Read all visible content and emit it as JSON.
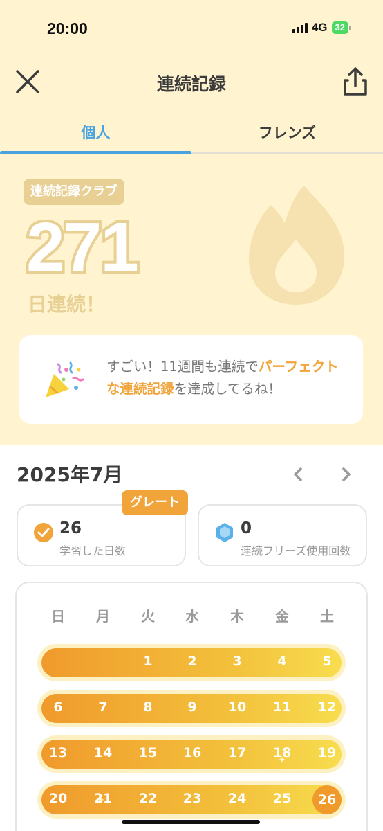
{
  "status_bar": {
    "time": "20:00",
    "network": "4G",
    "battery": "32"
  },
  "header": {
    "title": "連続記録",
    "close_icon": "close-icon",
    "share_icon": "share-icon"
  },
  "tabs": [
    {
      "label": "個人",
      "active": true
    },
    {
      "label": "フレンズ",
      "active": false
    }
  ],
  "streak": {
    "club_label": "連続記録クラブ",
    "count": "271",
    "unit": "日連続！"
  },
  "achievement": {
    "text_before": "すごい！11週間も連続で",
    "highlight_1": "パーフェクトな連続記録",
    "text_after": "を達成してるね！"
  },
  "calendar": {
    "month_title": "2025年7月",
    "great_badge": "グレート",
    "stats": {
      "study_days": {
        "value": "26",
        "label": "学習した日数"
      },
      "freeze_uses": {
        "value": "0",
        "label": "連続フリーズ使用回数"
      }
    },
    "weekdays": [
      "日",
      "月",
      "火",
      "水",
      "木",
      "金",
      "土"
    ],
    "weeks": [
      [
        "",
        "",
        "1",
        "2",
        "3",
        "4",
        "5"
      ],
      [
        "6",
        "7",
        "8",
        "9",
        "10",
        "11",
        "12"
      ],
      [
        "13",
        "14",
        "15",
        "16",
        "17",
        "18",
        "19"
      ],
      [
        "20",
        "21",
        "22",
        "23",
        "24",
        "25",
        "26"
      ]
    ],
    "today": "26"
  },
  "colors": {
    "background_top": "#fff4cf",
    "accent_blue": "#4aa3df",
    "accent_orange": "#f0a43a",
    "streak_tan": "#e8cf94"
  }
}
